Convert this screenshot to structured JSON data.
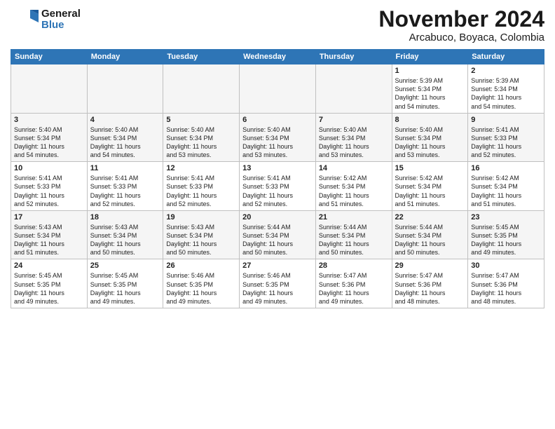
{
  "header": {
    "logo_line1": "General",
    "logo_line2": "Blue",
    "month": "November 2024",
    "location": "Arcabuco, Boyaca, Colombia"
  },
  "days_of_week": [
    "Sunday",
    "Monday",
    "Tuesday",
    "Wednesday",
    "Thursday",
    "Friday",
    "Saturday"
  ],
  "weeks": [
    {
      "cells": [
        {
          "day": "",
          "info": "",
          "empty": true
        },
        {
          "day": "",
          "info": "",
          "empty": true
        },
        {
          "day": "",
          "info": "",
          "empty": true
        },
        {
          "day": "",
          "info": "",
          "empty": true
        },
        {
          "day": "",
          "info": "",
          "empty": true
        },
        {
          "day": "1",
          "info": "Sunrise: 5:39 AM\nSunset: 5:34 PM\nDaylight: 11 hours\nand 54 minutes."
        },
        {
          "day": "2",
          "info": "Sunrise: 5:39 AM\nSunset: 5:34 PM\nDaylight: 11 hours\nand 54 minutes."
        }
      ]
    },
    {
      "cells": [
        {
          "day": "3",
          "info": "Sunrise: 5:40 AM\nSunset: 5:34 PM\nDaylight: 11 hours\nand 54 minutes."
        },
        {
          "day": "4",
          "info": "Sunrise: 5:40 AM\nSunset: 5:34 PM\nDaylight: 11 hours\nand 54 minutes."
        },
        {
          "day": "5",
          "info": "Sunrise: 5:40 AM\nSunset: 5:34 PM\nDaylight: 11 hours\nand 53 minutes."
        },
        {
          "day": "6",
          "info": "Sunrise: 5:40 AM\nSunset: 5:34 PM\nDaylight: 11 hours\nand 53 minutes."
        },
        {
          "day": "7",
          "info": "Sunrise: 5:40 AM\nSunset: 5:34 PM\nDaylight: 11 hours\nand 53 minutes."
        },
        {
          "day": "8",
          "info": "Sunrise: 5:40 AM\nSunset: 5:34 PM\nDaylight: 11 hours\nand 53 minutes."
        },
        {
          "day": "9",
          "info": "Sunrise: 5:41 AM\nSunset: 5:33 PM\nDaylight: 11 hours\nand 52 minutes."
        }
      ]
    },
    {
      "cells": [
        {
          "day": "10",
          "info": "Sunrise: 5:41 AM\nSunset: 5:33 PM\nDaylight: 11 hours\nand 52 minutes."
        },
        {
          "day": "11",
          "info": "Sunrise: 5:41 AM\nSunset: 5:33 PM\nDaylight: 11 hours\nand 52 minutes."
        },
        {
          "day": "12",
          "info": "Sunrise: 5:41 AM\nSunset: 5:33 PM\nDaylight: 11 hours\nand 52 minutes."
        },
        {
          "day": "13",
          "info": "Sunrise: 5:41 AM\nSunset: 5:33 PM\nDaylight: 11 hours\nand 52 minutes."
        },
        {
          "day": "14",
          "info": "Sunrise: 5:42 AM\nSunset: 5:34 PM\nDaylight: 11 hours\nand 51 minutes."
        },
        {
          "day": "15",
          "info": "Sunrise: 5:42 AM\nSunset: 5:34 PM\nDaylight: 11 hours\nand 51 minutes."
        },
        {
          "day": "16",
          "info": "Sunrise: 5:42 AM\nSunset: 5:34 PM\nDaylight: 11 hours\nand 51 minutes."
        }
      ]
    },
    {
      "cells": [
        {
          "day": "17",
          "info": "Sunrise: 5:43 AM\nSunset: 5:34 PM\nDaylight: 11 hours\nand 51 minutes."
        },
        {
          "day": "18",
          "info": "Sunrise: 5:43 AM\nSunset: 5:34 PM\nDaylight: 11 hours\nand 50 minutes."
        },
        {
          "day": "19",
          "info": "Sunrise: 5:43 AM\nSunset: 5:34 PM\nDaylight: 11 hours\nand 50 minutes."
        },
        {
          "day": "20",
          "info": "Sunrise: 5:44 AM\nSunset: 5:34 PM\nDaylight: 11 hours\nand 50 minutes."
        },
        {
          "day": "21",
          "info": "Sunrise: 5:44 AM\nSunset: 5:34 PM\nDaylight: 11 hours\nand 50 minutes."
        },
        {
          "day": "22",
          "info": "Sunrise: 5:44 AM\nSunset: 5:34 PM\nDaylight: 11 hours\nand 50 minutes."
        },
        {
          "day": "23",
          "info": "Sunrise: 5:45 AM\nSunset: 5:35 PM\nDaylight: 11 hours\nand 49 minutes."
        }
      ]
    },
    {
      "cells": [
        {
          "day": "24",
          "info": "Sunrise: 5:45 AM\nSunset: 5:35 PM\nDaylight: 11 hours\nand 49 minutes."
        },
        {
          "day": "25",
          "info": "Sunrise: 5:45 AM\nSunset: 5:35 PM\nDaylight: 11 hours\nand 49 minutes."
        },
        {
          "day": "26",
          "info": "Sunrise: 5:46 AM\nSunset: 5:35 PM\nDaylight: 11 hours\nand 49 minutes."
        },
        {
          "day": "27",
          "info": "Sunrise: 5:46 AM\nSunset: 5:35 PM\nDaylight: 11 hours\nand 49 minutes."
        },
        {
          "day": "28",
          "info": "Sunrise: 5:47 AM\nSunset: 5:36 PM\nDaylight: 11 hours\nand 49 minutes."
        },
        {
          "day": "29",
          "info": "Sunrise: 5:47 AM\nSunset: 5:36 PM\nDaylight: 11 hours\nand 48 minutes."
        },
        {
          "day": "30",
          "info": "Sunrise: 5:47 AM\nSunset: 5:36 PM\nDaylight: 11 hours\nand 48 minutes."
        }
      ]
    }
  ]
}
